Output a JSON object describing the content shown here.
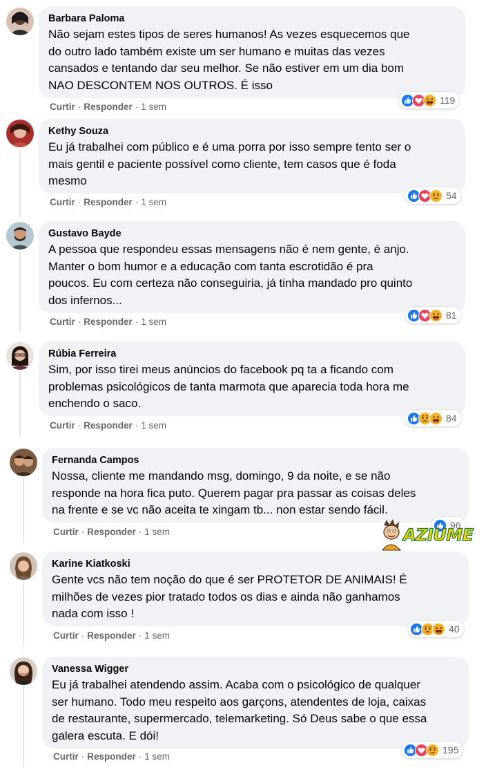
{
  "labels": {
    "like": "Curtir",
    "reply": "Responder",
    "sep": "·"
  },
  "comments": [
    {
      "author": "Barbara Paloma",
      "text": "Não sejam estes tipos de seres humanos! As vezes esquecemos que\ndo outro lado também existe um ser humano e muitas das vezes\ncansados e tentando dar seu melhor. Se não estiver em um dia bom\nNAO DESCONTEM NOS OUTROS. É isso",
      "time": "1 sem",
      "reactions": [
        "like-icon",
        "love-icon",
        "haha-icon"
      ],
      "count": "119"
    },
    {
      "author": "Kethy Souza",
      "text": "Eu já trabalhei com público e é uma porra por isso sempre tento ser o\nmais gentil e paciente possível como cliente, tem casos que é foda\nmesmo",
      "time": "1 sem",
      "reactions": [
        "like-icon",
        "love-icon",
        "sad-icon"
      ],
      "count": "54"
    },
    {
      "author": "Gustavo Bayde",
      "text": "A pessoa que respondeu essas mensagens não é nem gente, é anjo.\nManter o bom humor e a educação com tanta escrotidão é pra\npoucos. Eu com certeza não conseguiria, já tinha mandado pro quinto\ndos infernos...",
      "time": "1 sem",
      "reactions": [
        "like-icon",
        "love-icon",
        "haha-icon"
      ],
      "count": "81"
    },
    {
      "author": "Rúbia Ferreira",
      "text": "Sim, por isso tirei meus anúncios do facebook pq ta a ficando com\nproblemas psicológicos de tanta marmota que aparecia toda hora me\nenchendo o saco.",
      "time": "1 sem",
      "reactions": [
        "like-icon",
        "sad-icon",
        "haha-icon"
      ],
      "count": "84"
    },
    {
      "author": "Fernanda Campos",
      "text": "Nossa, cliente me mandando msg, domingo, 9 da noite, e se não\nresponde na hora fica puto. Querem pagar pra passar as coisas deles\nna frente e se vc não aceita te xingam tb... non estar sendo fácil.",
      "time": "1 sem",
      "reactions": [
        "like-icon"
      ],
      "count": "96"
    },
    {
      "author": "Karine Kiatkoski",
      "text": "Gente vcs não tem noção do que é ser PROTETOR DE ANIMAIS! É\nmilhões de vezes pior tratado todos os dias e ainda não ganhamos\nnada com isso !",
      "time": "1 sem",
      "reactions": [
        "like-icon",
        "sad-icon",
        "haha-icon"
      ],
      "count": "40"
    },
    {
      "author": "Vanessa Wigger",
      "text": "Eu já trabalhei atendendo assim. Acaba com o psicológico de qualquer\nser humano. Todo meu respeito aos garçons, atendentes de loja, caixas\nde restaurante, supermercado, telemarketing. Só Deus sabe o que essa\ngalera escuta. E dói!",
      "time": "1 sem",
      "reactions": [
        "like-icon",
        "love-icon",
        "sad-icon"
      ],
      "count": "195"
    }
  ],
  "watermark": {
    "text": "AZIUME"
  },
  "colors": {
    "bubble": "#f0f2f5",
    "meta": "#65676b",
    "like": "#1877f2",
    "love": "#f33e58",
    "emoji": "#f7b125",
    "watermark_fill": "#ffd400",
    "watermark_outline": "#0a7a3a"
  }
}
